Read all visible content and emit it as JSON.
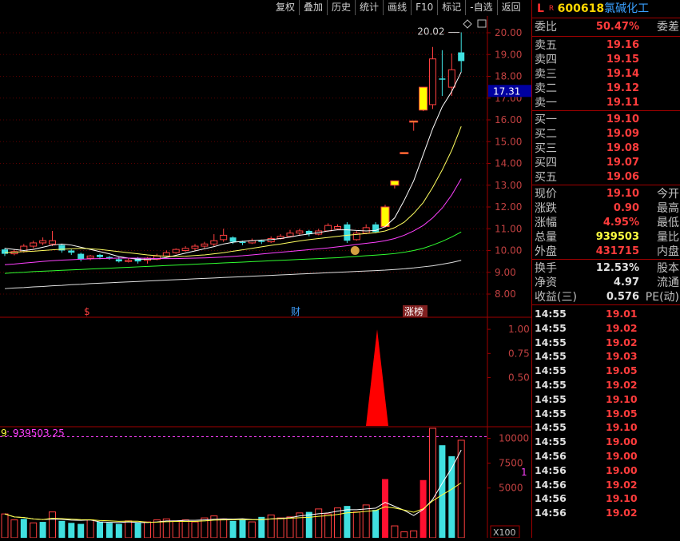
{
  "toolbar": [
    {
      "name": "fuquan-button",
      "label": "复权"
    },
    {
      "name": "overlay-button",
      "label": "叠加"
    },
    {
      "name": "history-button",
      "label": "历史"
    },
    {
      "name": "stats-button",
      "label": "统计"
    },
    {
      "name": "draw-line-button",
      "label": "画线"
    },
    {
      "name": "f10-button",
      "label": "F10"
    },
    {
      "name": "mark-button",
      "label": "标记"
    },
    {
      "name": "watchlist-button",
      "label": "-自选"
    },
    {
      "name": "back-button",
      "label": "返回"
    }
  ],
  "stock": {
    "l_mark": "L",
    "r_mark": "R",
    "code": "600618",
    "name": "氯碱化工"
  },
  "weibi": {
    "label": "委比",
    "value": "50.47%",
    "label2": "委差"
  },
  "asks": [
    {
      "label": "卖五",
      "price": "19.16"
    },
    {
      "label": "卖四",
      "price": "19.15"
    },
    {
      "label": "卖三",
      "price": "19.14"
    },
    {
      "label": "卖二",
      "price": "19.12"
    },
    {
      "label": "卖一",
      "price": "19.11"
    }
  ],
  "bids": [
    {
      "label": "买一",
      "price": "19.10"
    },
    {
      "label": "买二",
      "price": "19.09"
    },
    {
      "label": "买三",
      "price": "19.08"
    },
    {
      "label": "买四",
      "price": "19.07"
    },
    {
      "label": "买五",
      "price": "19.06"
    }
  ],
  "quote": [
    {
      "l1": "现价",
      "v1": "19.10",
      "l2": "今开",
      "c": "red"
    },
    {
      "l1": "涨跌",
      "v1": "0.90",
      "l2": "最高",
      "c": "red"
    },
    {
      "l1": "涨幅",
      "v1": "4.95%",
      "l2": "最低",
      "c": "red"
    },
    {
      "l1": "总量",
      "v1": "939503",
      "l2": "量比",
      "c": "yellow"
    },
    {
      "l1": "外盘",
      "v1": "431715",
      "l2": "内盘",
      "c": "red"
    }
  ],
  "fundamentals": [
    {
      "l1": "换手",
      "v1": "12.53%",
      "l2": "股本"
    },
    {
      "l1": "净资",
      "v1": "4.97",
      "l2": "流通"
    },
    {
      "l1": "收益(三)",
      "v1": "0.576",
      "l2": "PE(动)"
    }
  ],
  "ticks": [
    {
      "time": "14:55",
      "price": "19.01"
    },
    {
      "time": "14:55",
      "price": "19.02"
    },
    {
      "time": "14:55",
      "price": "19.02"
    },
    {
      "time": "14:55",
      "price": "19.03"
    },
    {
      "time": "14:55",
      "price": "19.05"
    },
    {
      "time": "14:55",
      "price": "19.02"
    },
    {
      "time": "14:55",
      "price": "19.10"
    },
    {
      "time": "14:55",
      "price": "19.05"
    },
    {
      "time": "14:55",
      "price": "19.10"
    },
    {
      "time": "14:55",
      "price": "19.00"
    },
    {
      "time": "14:56",
      "price": "19.00"
    },
    {
      "time": "14:56",
      "price": "19.00"
    },
    {
      "time": "14:56",
      "price": "19.02"
    },
    {
      "time": "14:56",
      "price": "19.10"
    },
    {
      "time": "14:56",
      "price": "19.02"
    }
  ],
  "chart": {
    "price_axis": [
      "20.00",
      "19.00",
      "18.00",
      "17.00",
      "16.00",
      "15.00",
      "14.00",
      "13.00",
      "12.00",
      "11.00",
      "10.00",
      "9.00",
      "8.00"
    ],
    "high_label": "20.02",
    "current_price_tag": "17.31",
    "markers": [
      "$",
      "财",
      "涨榜"
    ],
    "indicator_axis": [
      "1.00",
      "0.75",
      "0.50"
    ],
    "volume_label_prefix": "9",
    "volume_label": ": 939503.25",
    "volume_axis": [
      "10000",
      "7500",
      "5000"
    ],
    "volume_unit": "X100",
    "right_edge_mark": "1"
  },
  "chart_data": {
    "type": "candlestick",
    "price_range": [
      7.5,
      20.6
    ],
    "candles": [
      [
        10.05,
        9.85,
        10.12,
        9.75,
        "down"
      ],
      [
        9.85,
        9.95,
        10.05,
        9.78,
        "up"
      ],
      [
        9.95,
        10.2,
        10.3,
        9.9,
        "up"
      ],
      [
        10.2,
        10.35,
        10.45,
        10.1,
        "up"
      ],
      [
        10.35,
        10.45,
        10.6,
        10.25,
        "up"
      ],
      [
        10.3,
        10.45,
        10.9,
        10.2,
        "up"
      ],
      [
        10.25,
        10.0,
        10.3,
        9.9,
        "down"
      ],
      [
        10.0,
        9.9,
        10.05,
        9.8,
        "down"
      ],
      [
        9.85,
        9.6,
        9.9,
        9.5,
        "down"
      ],
      [
        9.65,
        9.75,
        9.8,
        9.55,
        "up"
      ],
      [
        9.8,
        9.7,
        9.85,
        9.6,
        "down"
      ],
      [
        9.7,
        9.65,
        9.75,
        9.58,
        "down"
      ],
      [
        9.6,
        9.5,
        9.7,
        9.45,
        "down"
      ],
      [
        9.55,
        9.55,
        9.65,
        9.45,
        "up"
      ],
      [
        9.5,
        9.65,
        9.7,
        9.4,
        "down"
      ],
      [
        9.55,
        9.65,
        9.7,
        9.4,
        "up"
      ],
      [
        9.6,
        9.75,
        9.85,
        9.55,
        "up"
      ],
      [
        9.75,
        9.9,
        10.0,
        9.7,
        "up"
      ],
      [
        9.9,
        10.05,
        10.1,
        9.85,
        "up"
      ],
      [
        10.0,
        10.1,
        10.2,
        9.95,
        "up"
      ],
      [
        10.1,
        10.2,
        10.3,
        10.0,
        "up"
      ],
      [
        10.2,
        10.3,
        10.4,
        10.1,
        "up"
      ],
      [
        10.3,
        10.45,
        10.75,
        10.2,
        "up"
      ],
      [
        10.5,
        10.7,
        11.0,
        10.4,
        "up"
      ],
      [
        10.6,
        10.4,
        10.65,
        10.3,
        "down"
      ],
      [
        10.4,
        10.35,
        10.45,
        10.25,
        "down"
      ],
      [
        10.35,
        10.45,
        10.55,
        10.3,
        "up"
      ],
      [
        10.45,
        10.4,
        10.5,
        10.3,
        "down"
      ],
      [
        10.4,
        10.55,
        10.65,
        10.35,
        "up"
      ],
      [
        10.55,
        10.65,
        10.75,
        10.5,
        "up"
      ],
      [
        10.65,
        10.8,
        10.95,
        10.6,
        "up"
      ],
      [
        10.8,
        10.9,
        11.0,
        10.7,
        "up"
      ],
      [
        10.9,
        10.75,
        10.95,
        10.65,
        "down"
      ],
      [
        10.75,
        10.9,
        11.0,
        10.7,
        "up"
      ],
      [
        10.9,
        11.15,
        11.25,
        10.85,
        "up"
      ],
      [
        11.1,
        11.0,
        11.2,
        10.95,
        "up"
      ],
      [
        11.2,
        10.45,
        11.3,
        10.35,
        "down"
      ],
      [
        10.5,
        10.8,
        10.9,
        10.45,
        "up"
      ],
      [
        10.8,
        11.05,
        11.2,
        10.75,
        "up"
      ],
      [
        10.85,
        11.2,
        11.3,
        10.8,
        "down"
      ],
      [
        11.1,
        12.0,
        12.1,
        11.05,
        "limit"
      ],
      [
        13.0,
        13.2,
        13.2,
        12.85,
        "limit"
      ],
      [
        14.5,
        14.5,
        14.5,
        14.5,
        "limit"
      ],
      [
        15.95,
        15.95,
        15.95,
        15.5,
        "limit"
      ],
      [
        16.45,
        17.5,
        17.5,
        16.4,
        "limit"
      ],
      [
        16.7,
        18.8,
        19.35,
        16.5,
        "up"
      ],
      [
        17.9,
        17.9,
        19.2,
        17.1,
        "down"
      ],
      [
        17.5,
        18.3,
        19.05,
        17.1,
        "up"
      ],
      [
        18.7,
        19.1,
        20.02,
        18.2,
        "down"
      ]
    ],
    "ma": [
      {
        "name": "MA5",
        "color": "#ffffff",
        "values": [
          10.1,
          10.05,
          10.0,
          10.05,
          10.15,
          10.25,
          10.3,
          10.25,
          10.15,
          10.05,
          9.95,
          9.85,
          9.72,
          9.65,
          9.6,
          9.6,
          9.62,
          9.68,
          9.78,
          9.88,
          9.98,
          10.08,
          10.18,
          10.3,
          10.38,
          10.42,
          10.45,
          10.48,
          10.5,
          10.55,
          10.62,
          10.7,
          10.76,
          10.82,
          10.9,
          10.95,
          10.95,
          10.92,
          10.9,
          10.92,
          11.1,
          11.5,
          12.3,
          13.2,
          14.4,
          15.6,
          16.6,
          17.3,
          18.2
        ]
      },
      {
        "name": "MA10",
        "color": "#ffff60",
        "values": [
          9.9,
          9.92,
          9.95,
          9.97,
          10.0,
          10.03,
          10.06,
          10.08,
          10.1,
          10.08,
          10.05,
          10.0,
          9.95,
          9.9,
          9.85,
          9.8,
          9.76,
          9.74,
          9.73,
          9.74,
          9.77,
          9.8,
          9.85,
          9.9,
          9.97,
          10.03,
          10.1,
          10.17,
          10.24,
          10.3,
          10.37,
          10.44,
          10.5,
          10.55,
          10.6,
          10.65,
          10.7,
          10.74,
          10.78,
          10.82,
          10.9,
          11.05,
          11.3,
          11.7,
          12.2,
          12.9,
          13.7,
          14.6,
          15.7
        ]
      },
      {
        "name": "MA20",
        "color": "#ff40ff",
        "values": [
          9.35,
          9.38,
          9.42,
          9.46,
          9.5,
          9.53,
          9.56,
          9.58,
          9.6,
          9.62,
          9.63,
          9.64,
          9.65,
          9.65,
          9.65,
          9.64,
          9.63,
          9.63,
          9.63,
          9.64,
          9.65,
          9.66,
          9.68,
          9.7,
          9.73,
          9.76,
          9.8,
          9.84,
          9.88,
          9.92,
          9.96,
          10.0,
          10.04,
          10.08,
          10.12,
          10.17,
          10.22,
          10.28,
          10.33,
          10.38,
          10.45,
          10.55,
          10.7,
          10.9,
          11.15,
          11.5,
          11.95,
          12.55,
          13.3
        ]
      },
      {
        "name": "MA30",
        "color": "#30ff30",
        "values": [
          8.95,
          8.98,
          9.0,
          9.03,
          9.05,
          9.07,
          9.09,
          9.11,
          9.13,
          9.15,
          9.17,
          9.19,
          9.21,
          9.23,
          9.25,
          9.27,
          9.29,
          9.31,
          9.33,
          9.35,
          9.37,
          9.39,
          9.41,
          9.43,
          9.45,
          9.47,
          9.49,
          9.51,
          9.53,
          9.55,
          9.57,
          9.59,
          9.61,
          9.63,
          9.65,
          9.67,
          9.7,
          9.73,
          9.76,
          9.79,
          9.82,
          9.86,
          9.92,
          10.0,
          10.1,
          10.25,
          10.42,
          10.62,
          10.85
        ]
      },
      {
        "name": "MA60",
        "color": "#e0e0e0",
        "values": [
          8.25,
          8.28,
          8.3,
          8.33,
          8.35,
          8.38,
          8.4,
          8.43,
          8.45,
          8.48,
          8.5,
          8.52,
          8.54,
          8.56,
          8.58,
          8.6,
          8.62,
          8.64,
          8.66,
          8.68,
          8.7,
          8.72,
          8.74,
          8.76,
          8.78,
          8.8,
          8.82,
          8.84,
          8.86,
          8.88,
          8.9,
          8.92,
          8.94,
          8.96,
          8.98,
          9.0,
          9.02,
          9.04,
          9.06,
          9.08,
          9.1,
          9.13,
          9.16,
          9.2,
          9.25,
          9.3,
          9.37,
          9.45,
          9.55
        ]
      }
    ],
    "indicator": {
      "range": [
        0,
        1.1
      ],
      "peak_index": 40,
      "peak_value": 1.0
    },
    "volume": {
      "range": [
        0,
        11000
      ],
      "values": [
        2400,
        1800,
        1900,
        1500,
        1600,
        2600,
        1700,
        1500,
        1400,
        1800,
        1600,
        1500,
        1400,
        1700,
        1500,
        1600,
        1800,
        1900,
        1700,
        1800,
        1600,
        2000,
        2200,
        1900,
        1700,
        1800,
        1600,
        2100,
        2300,
        2000,
        2100,
        2500,
        2600,
        2900,
        2400,
        3000,
        3200,
        2600,
        3300,
        2800,
        5900,
        1200,
        600,
        700,
        5800,
        11000,
        9300,
        8200,
        9800
      ],
      "colors": [
        "up",
        "up",
        "down",
        "up",
        "down",
        "up",
        "down",
        "down",
        "down",
        "up",
        "down",
        "down",
        "down",
        "up",
        "down",
        "up",
        "up",
        "up",
        "up",
        "up",
        "up",
        "up",
        "up",
        "up",
        "down",
        "down",
        "up",
        "down",
        "up",
        "up",
        "up",
        "up",
        "down",
        "up",
        "up",
        "up",
        "down",
        "up",
        "up",
        "down",
        "limit",
        "up",
        "up",
        "up",
        "limit",
        "up",
        "down",
        "down",
        "up"
      ]
    }
  }
}
